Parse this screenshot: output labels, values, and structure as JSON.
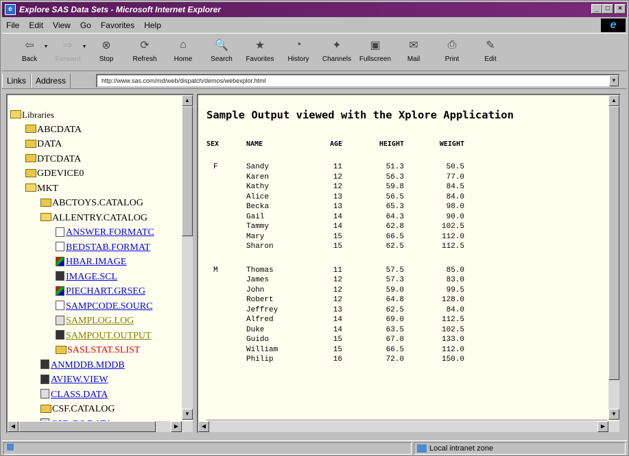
{
  "window": {
    "title": "Explore SAS Data Sets - Microsoft Internet Explorer"
  },
  "menu": [
    "File",
    "Edit",
    "View",
    "Go",
    "Favorites",
    "Help"
  ],
  "toolbar": [
    {
      "label": "Back",
      "icon": "back-arrow-icon",
      "glyph": "⇦",
      "disabled": false,
      "dropdown": true
    },
    {
      "label": "Forward",
      "icon": "forward-arrow-icon",
      "glyph": "⇨",
      "disabled": true,
      "dropdown": true
    },
    {
      "label": "Stop",
      "icon": "stop-icon",
      "glyph": "⊗",
      "disabled": false
    },
    {
      "label": "Refresh",
      "icon": "refresh-icon",
      "glyph": "⟳",
      "disabled": false
    },
    {
      "label": "Home",
      "icon": "home-icon",
      "glyph": "⌂",
      "disabled": false
    },
    {
      "label": "Search",
      "icon": "search-icon",
      "glyph": "🔍",
      "disabled": false
    },
    {
      "label": "Favorites",
      "icon": "favorites-icon",
      "glyph": "★",
      "disabled": false
    },
    {
      "label": "History",
      "icon": "history-icon",
      "glyph": "◔",
      "disabled": false
    },
    {
      "label": "Channels",
      "icon": "channels-icon",
      "glyph": "✦",
      "disabled": false
    },
    {
      "label": "Fullscreen",
      "icon": "fullscreen-icon",
      "glyph": "▣",
      "disabled": false
    },
    {
      "label": "Mail",
      "icon": "mail-icon",
      "glyph": "✉",
      "disabled": false
    },
    {
      "label": "Print",
      "icon": "print-icon",
      "glyph": "⎙",
      "disabled": false
    },
    {
      "label": "Edit",
      "icon": "edit-icon",
      "glyph": "✎",
      "disabled": false
    }
  ],
  "links_label": "Links",
  "address_label": "Address",
  "address_value": "http://www.sas.com/md/web/dispatch/demos/webexplor.html",
  "tree": [
    {
      "indent": 0,
      "label": "Libraries",
      "kind": "open",
      "link": false,
      "color": "#000"
    },
    {
      "indent": 1,
      "label": "ABCDATA",
      "kind": "folder",
      "link": false,
      "color": "#000"
    },
    {
      "indent": 1,
      "label": "DATA",
      "kind": "folder",
      "link": false,
      "color": "#000"
    },
    {
      "indent": 1,
      "label": "DTCDATA",
      "kind": "folder",
      "link": false,
      "color": "#000"
    },
    {
      "indent": 1,
      "label": "GDEVICE0",
      "kind": "folder",
      "link": false,
      "color": "#000"
    },
    {
      "indent": 1,
      "label": "MKT",
      "kind": "open",
      "link": false,
      "color": "#000"
    },
    {
      "indent": 2,
      "label": "ABCTOYS.CATALOG",
      "kind": "folder",
      "link": false,
      "color": "#000"
    },
    {
      "indent": 2,
      "label": "ALLENTRY.CATALOG",
      "kind": "open",
      "link": false,
      "color": "#000"
    },
    {
      "indent": 3,
      "label": "ANSWER.FORMATC",
      "kind": "file",
      "link": true,
      "color": "#0000ee"
    },
    {
      "indent": 3,
      "label": "BEDSTAB.FORMAT",
      "kind": "file",
      "link": true,
      "color": "#0000ee"
    },
    {
      "indent": 3,
      "label": "HBAR.IMAGE",
      "kind": "img",
      "link": true,
      "color": "#0000ee"
    },
    {
      "indent": 3,
      "label": "IMAGE.SCL",
      "kind": "dark",
      "link": true,
      "color": "#0000ee"
    },
    {
      "indent": 3,
      "label": "PIECHART.GRSEG",
      "kind": "img",
      "link": true,
      "color": "#0000ee"
    },
    {
      "indent": 3,
      "label": "SAMPCODE.SOURC",
      "kind": "file",
      "link": true,
      "color": "#0000ee"
    },
    {
      "indent": 3,
      "label": "SAMPLOG.LOG",
      "kind": "gray",
      "link": true,
      "color": "#808000"
    },
    {
      "indent": 3,
      "label": "SAMPOUT.OUTPUT",
      "kind": "dark",
      "link": true,
      "color": "#808000"
    },
    {
      "indent": 3,
      "label": "SASLSTAT.SLIST",
      "kind": "folder",
      "link": false,
      "color": "#e00000"
    },
    {
      "indent": 2,
      "label": "ANMDDB.MDDB",
      "kind": "dark",
      "link": true,
      "color": "#0000ee"
    },
    {
      "indent": 2,
      "label": "AVIEW.VIEW",
      "kind": "dark",
      "link": true,
      "color": "#0000ee"
    },
    {
      "indent": 2,
      "label": "CLASS.DATA",
      "kind": "gray",
      "link": true,
      "color": "#0000ee"
    },
    {
      "indent": 2,
      "label": "CSF.CATALOG",
      "kind": "folder",
      "link": false,
      "color": "#000"
    },
    {
      "indent": 2,
      "label": "CSF_DS.DATA",
      "kind": "gray",
      "link": true,
      "color": "#0000ee"
    }
  ],
  "output": {
    "title": "Sample Output viewed with the Xplore Application",
    "headers": [
      "SEX",
      "NAME",
      "AGE",
      "HEIGHT",
      "WEIGHT"
    ],
    "groups": [
      {
        "sex": "F",
        "rows": [
          [
            "Sandy",
            "11",
            "51.3",
            "50.5"
          ],
          [
            "Karen",
            "12",
            "56.3",
            "77.0"
          ],
          [
            "Kathy",
            "12",
            "59.8",
            "84.5"
          ],
          [
            "Alice",
            "13",
            "56.5",
            "84.0"
          ],
          [
            "Becka",
            "13",
            "65.3",
            "98.0"
          ],
          [
            "Gail",
            "14",
            "64.3",
            "90.0"
          ],
          [
            "Tammy",
            "14",
            "62.8",
            "102.5"
          ],
          [
            "Mary",
            "15",
            "66.5",
            "112.0"
          ],
          [
            "Sharon",
            "15",
            "62.5",
            "112.5"
          ]
        ]
      },
      {
        "sex": "M",
        "rows": [
          [
            "Thomas",
            "11",
            "57.5",
            "85.0"
          ],
          [
            "James",
            "12",
            "57.3",
            "83.0"
          ],
          [
            "John",
            "12",
            "59.0",
            "99.5"
          ],
          [
            "Robert",
            "12",
            "64.8",
            "128.0"
          ],
          [
            "Jeffrey",
            "13",
            "62.5",
            "84.0"
          ],
          [
            "Alfred",
            "14",
            "69.0",
            "112.5"
          ],
          [
            "Duke",
            "14",
            "63.5",
            "102.5"
          ],
          [
            "Guido",
            "15",
            "67.0",
            "133.0"
          ],
          [
            "William",
            "15",
            "66.5",
            "112.0"
          ],
          [
            "Philip",
            "16",
            "72.0",
            "150.0"
          ]
        ]
      }
    ]
  },
  "status": {
    "left": "",
    "zone": "Local intranet zone"
  }
}
